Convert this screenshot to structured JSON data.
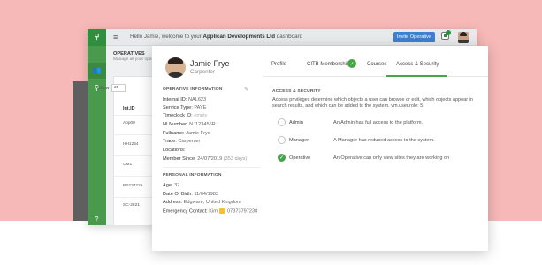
{
  "app": {
    "welcome_prefix": "Hello Jamie, welcome to your",
    "company": "Applican Developments Ltd",
    "welcome_suffix": "dashboard",
    "invite_button": "Invite Operative",
    "notification_count": "1"
  },
  "operatives_list": {
    "title": "OPERATIVES",
    "subtitle": "Manage all your operatives",
    "show_label": "Show",
    "show_value": "25",
    "column_header": "Int.ID",
    "rows": [
      "App00",
      "HH1254",
      "CM1",
      "BS234225",
      "SC-2821"
    ]
  },
  "profile": {
    "name": "Jamie Frye",
    "role": "Carpenter",
    "tabs": [
      "Profile",
      "CITB Membership",
      "Courses",
      "Access & Security"
    ],
    "active_tab": "Access & Security",
    "operative_info_title": "OPERATIVE INFORMATION",
    "operative_info": [
      {
        "label": "Internal ID:",
        "value": "NAL623"
      },
      {
        "label": "Service Type:",
        "value": "PAYE"
      },
      {
        "label": "Timeclock ID:",
        "value": "empty"
      },
      {
        "label": "NI Number:",
        "value": "NJ123456R"
      },
      {
        "label": "Fullname:",
        "value": "Jamie Frye"
      },
      {
        "label": "Trade:",
        "value": "Carpenter"
      },
      {
        "label": "Locations:",
        "value": ""
      },
      {
        "label": "Member Since:",
        "value": "24/07/2019",
        "extra": "(353 days)"
      }
    ],
    "personal_info_title": "PERSONAL INFORMATION",
    "personal_info": [
      {
        "label": "Age:",
        "value": "37"
      },
      {
        "label": "Date Of Birth:",
        "value": "11/04/1983"
      },
      {
        "label": "Address:",
        "value": "Edgware, United Kingdom"
      },
      {
        "label": "Emergency Contact:",
        "value": "Kim",
        "phone": "07373797238"
      }
    ]
  },
  "access": {
    "title": "ACCESS & SECURITY",
    "description": "Access privileges determine which objects a user can browse or edit, which objects appear in search results, and which can be added to the system. vm.user.role: 5",
    "roles": [
      {
        "name": "Admin",
        "description": "An Admin has full access to the platform.",
        "selected": false
      },
      {
        "name": "Manager",
        "description": "A Manager has reduced access to the system.",
        "selected": false
      },
      {
        "name": "Operative",
        "description": "An Operative can only view sites they are working on",
        "selected": true
      }
    ]
  },
  "colors": {
    "background": "#f6b9b7",
    "brand_green": "#46a548",
    "invite_blue": "#3d7fd1"
  }
}
